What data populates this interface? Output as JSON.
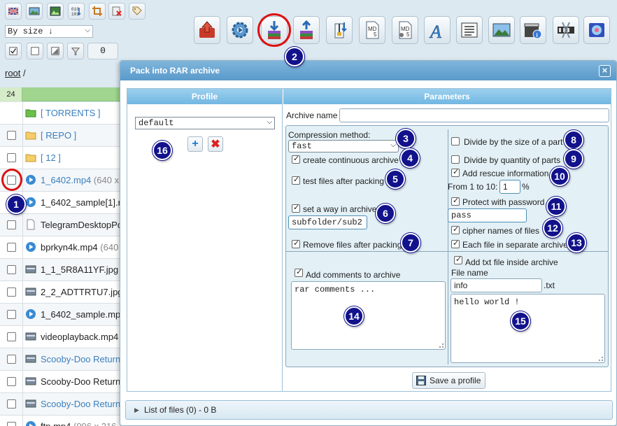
{
  "toolbar": {
    "small_buttons": [
      "flag-icon",
      "image-edit-icon",
      "picture-icon",
      "binary-icon",
      "crop-icon",
      "delete-image-icon",
      "tag-icon"
    ],
    "sort_select": "By size ↓",
    "selection_count": "0",
    "big_buttons": [
      "upload-icon",
      "settings-icon",
      "pack-rar-icon",
      "extract-icon",
      "zip-icon",
      "md5-icon",
      "md5-check-icon",
      "font-icon",
      "list-icon",
      "image-icon",
      "info-icon",
      "video-icon",
      "cut-icon",
      "gallery-icon"
    ]
  },
  "breadcrumb": {
    "root": "root",
    "sep": "/"
  },
  "file_list": {
    "count": "24",
    "rows": [
      {
        "icon": "folder-green-icon",
        "name": "[ TORRENTS ]",
        "extra": "",
        "type": "dir",
        "checkbox": false
      },
      {
        "icon": "folder-icon",
        "name": "[ REPO ]",
        "extra": "",
        "type": "dir",
        "checkbox": true
      },
      {
        "icon": "folder-icon",
        "name": "[ 12 ]",
        "extra": "",
        "type": "dir",
        "checkbox": true
      },
      {
        "icon": "video-icon",
        "name": "1_6402.mp4",
        "extra": "(640 x",
        "type": "link",
        "checkbox": true
      },
      {
        "icon": "video-icon",
        "name": "1_6402_sample[1].r",
        "extra": "",
        "type": "file",
        "checkbox": true
      },
      {
        "icon": "document-icon",
        "name": "TelegramDesktopPo",
        "extra": "",
        "type": "file",
        "checkbox": true
      },
      {
        "icon": "video-icon",
        "name": "bprkyn4k.mp4",
        "extra": "(640",
        "type": "file",
        "checkbox": true
      },
      {
        "icon": "image-file-icon",
        "name": "1_1_5R8A11YF.jpg",
        "extra": "",
        "type": "file",
        "checkbox": true
      },
      {
        "icon": "image-file-icon",
        "name": "2_2_ADTTRTU7.jpg",
        "extra": "",
        "type": "file",
        "checkbox": true
      },
      {
        "icon": "video-icon",
        "name": "1_6402_sample.mp",
        "extra": "",
        "type": "file",
        "checkbox": true
      },
      {
        "icon": "image-file-icon",
        "name": "videoplayback.mp4",
        "extra": "",
        "type": "file",
        "checkbox": true
      },
      {
        "icon": "image-file-icon",
        "name": "Scooby-Doo Return",
        "extra": "",
        "type": "link",
        "checkbox": true
      },
      {
        "icon": "image-file-icon",
        "name": "Scooby-Doo Return",
        "extra": "",
        "type": "file",
        "checkbox": true
      },
      {
        "icon": "image-file-icon",
        "name": "Scooby-Doo Return",
        "extra": "",
        "type": "link",
        "checkbox": true
      },
      {
        "icon": "video-icon",
        "name": "ftp.mp4",
        "extra": "(096 x 216",
        "type": "file",
        "checkbox": true
      }
    ]
  },
  "dialog": {
    "title": "Pack into RAR archive",
    "close": "×",
    "profile_header": "Profile",
    "params_header": "Parameters",
    "profile_value": "default",
    "add_profile": "+",
    "remove_profile": "✖",
    "archive_name_label": "Archive name",
    "archive_name_value": "",
    "compression_label": "Compression method:",
    "compression_value": "fast",
    "continuous": "create continuous archive",
    "test_files": "test files after packing",
    "set_way": "set a way in archive",
    "way_value": "subfolder/sub2",
    "remove_files": "Remove files after packing",
    "divide_size": "Divide by the size of a part",
    "divide_qty": "Divide by quantity of parts",
    "rescue": "Add rescue information",
    "rescue_range": "From 1 to 10:",
    "rescue_value": "1",
    "rescue_unit": "%",
    "protect": "Protect with password",
    "password_value": "pass",
    "cipher": "cipher names of files",
    "each_file": "Each file in separate archive",
    "add_comments": "Add comments to archive",
    "comments_value": "rar comments ...",
    "add_txt": "Add txt file inside archive",
    "file_name_label": "File name",
    "file_name_value": "info",
    "txt_ext": ".txt",
    "txt_content": "hello world !",
    "save_profile": "Save a profile",
    "files_bar": "List of files (0) - 0 B"
  },
  "callouts": [
    "1",
    "2",
    "3",
    "4",
    "5",
    "6",
    "7",
    "8",
    "9",
    "10",
    "11",
    "12",
    "13",
    "14",
    "15",
    "16"
  ],
  "colors": {
    "callout": "#12128c",
    "ring": "#dd1111",
    "header": "#72b7e2",
    "list_header": "#9fd58e"
  }
}
